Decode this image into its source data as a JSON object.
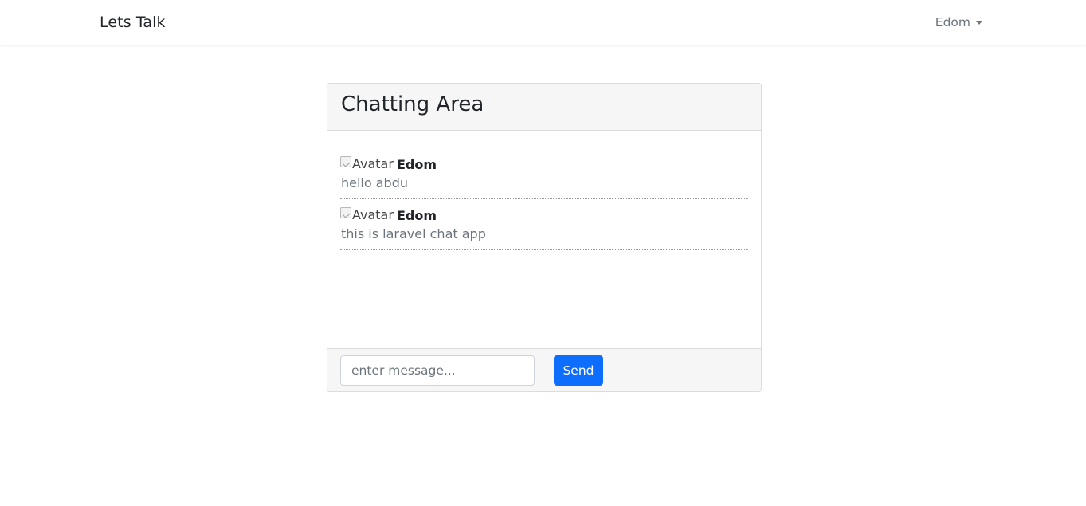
{
  "navbar": {
    "brand": "Lets Talk",
    "user_name": "Edom"
  },
  "chat": {
    "title": "Chatting Area",
    "messages": [
      {
        "avatar_alt": "Avatar",
        "author": "Edom",
        "text": "hello abdu"
      },
      {
        "avatar_alt": "Avatar",
        "author": "Edom",
        "text": "this is laravel chat app"
      }
    ],
    "input": {
      "placeholder": "enter message...",
      "value": ""
    },
    "send_label": "Send"
  },
  "colors": {
    "primary": "#0d6efd",
    "muted_text": "#6c757d",
    "card_header_bg": "#f6f6f6"
  }
}
